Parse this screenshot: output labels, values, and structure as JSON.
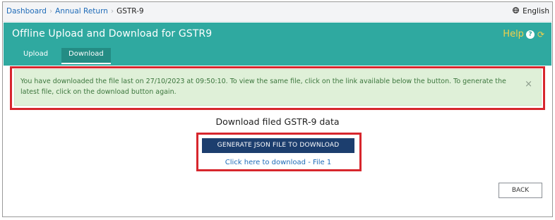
{
  "breadcrumb": {
    "items": [
      "Dashboard",
      "Annual Return",
      "GSTR-9"
    ],
    "separator": "›"
  },
  "language": {
    "label": "English",
    "icon": "globe-icon"
  },
  "header": {
    "title": "Offline Upload and Download for GSTR9",
    "help_label": "Help",
    "help_icon": "question-icon",
    "refresh_icon": "refresh-icon",
    "tabs": [
      {
        "label": "Upload",
        "active": false
      },
      {
        "label": "Download",
        "active": true
      }
    ]
  },
  "alert": {
    "message": "You have downloaded the file last on 27/10/2023 at 09:50:10. To view the same file, click on the link available below the button. To generate the latest file, click on the download button again.",
    "close_glyph": "×"
  },
  "download": {
    "title": "Download filed GSTR-9 data",
    "generate_button": "GENERATE JSON FILE TO DOWNLOAD",
    "file_link": "Click here to download - File 1"
  },
  "footer": {
    "back_button": "BACK"
  },
  "colors": {
    "header_bg": "#2fa9a0",
    "tab_active_bg": "#248c84",
    "help": "#f2d04a",
    "alert_bg": "#dff0d8",
    "alert_text": "#3c763d",
    "primary_button": "#1c3e6e",
    "link": "#1e6bb8",
    "highlight_outline": "#d7262d"
  }
}
